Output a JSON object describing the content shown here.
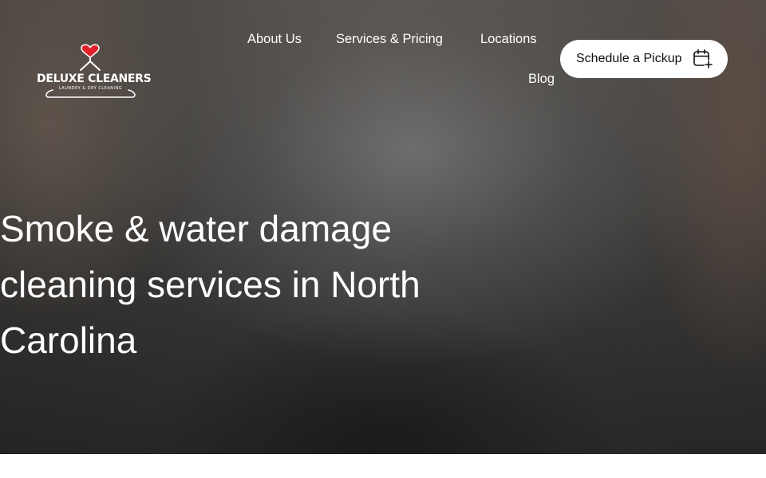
{
  "brand": {
    "name": "DELUXE CLEANERS",
    "tagline": "LAUNDRY & DRY CLEANING",
    "heart_color": "#e0202a",
    "icons": [
      "heart-icon",
      "hanger-icon"
    ]
  },
  "nav": {
    "items": [
      {
        "label": "About Us"
      },
      {
        "label": "Services & Pricing"
      },
      {
        "label": "Locations"
      },
      {
        "label": "Blog"
      }
    ]
  },
  "cta": {
    "label": "Schedule a Pickup",
    "icon": "calendar-plus-icon"
  },
  "hero": {
    "headline": "Smoke & water damage cleaning services in North Carolina"
  },
  "colors": {
    "text_on_hero": "#ffffff",
    "button_bg": "#ffffff",
    "button_text": "#111111",
    "page_bg": "#ffffff"
  }
}
